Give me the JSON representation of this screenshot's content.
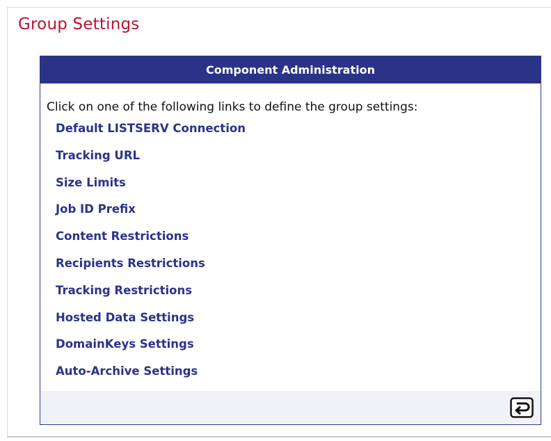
{
  "page": {
    "title": "Group Settings"
  },
  "panel": {
    "header": "Component Administration",
    "intro": "Click on one of the following links to define the group settings:",
    "links": [
      "Default LISTSERV Connection",
      "Tracking URL",
      "Size Limits",
      "Job ID Prefix",
      "Content Restrictions",
      "Recipients Restrictions",
      "Tracking Restrictions",
      "Hosted Data Settings",
      "DomainKeys Settings",
      "Auto-Archive Settings"
    ],
    "back_icon": "return-arrow-icon"
  },
  "colors": {
    "title": "#c0112e",
    "header_bg": "#2b3388",
    "link": "#2b3388",
    "footer_bg": "#f1f2f8"
  }
}
